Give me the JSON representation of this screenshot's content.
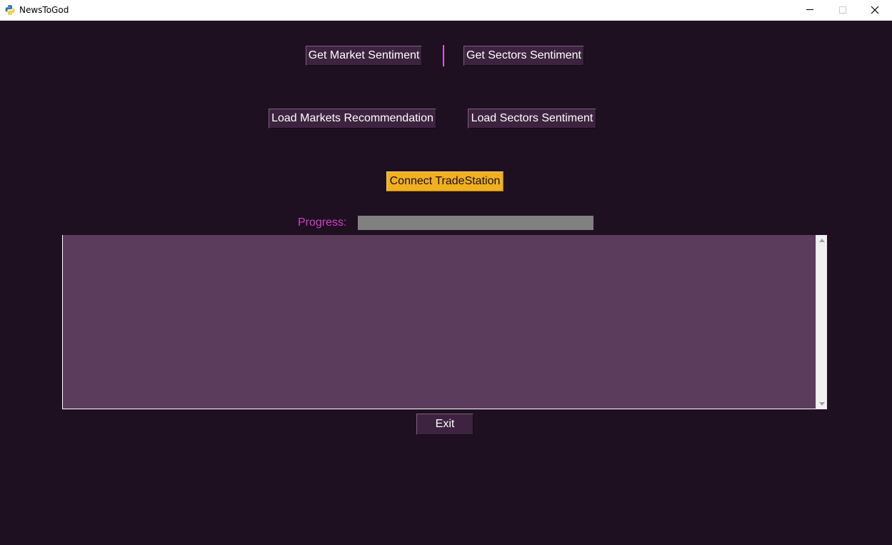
{
  "window": {
    "title": "NewsToGod",
    "icons": {
      "app": "python-icon",
      "minimize": "minimize-icon",
      "maximize": "maximize-icon",
      "close": "close-icon"
    }
  },
  "buttons": {
    "get_market_sentiment": "Get Market Sentiment",
    "get_sectors_sentiment": "Get Sectors Sentiment",
    "load_markets_recommendation": "Load Markets Recommendation",
    "load_sectors_sentiment": "Load Sectors Sentiment",
    "connect_tradestation": "Connect TradeStation",
    "exit": "Exit"
  },
  "progress": {
    "label": "Progress:",
    "value_percent": 0
  },
  "output": {
    "value": ""
  },
  "colors": {
    "background": "#1e1021",
    "button": "#3d2340",
    "accent": "#f0b020",
    "progress_label": "#d23fc8",
    "progress_track": "#808080",
    "output_area": "#5c3c5c"
  }
}
